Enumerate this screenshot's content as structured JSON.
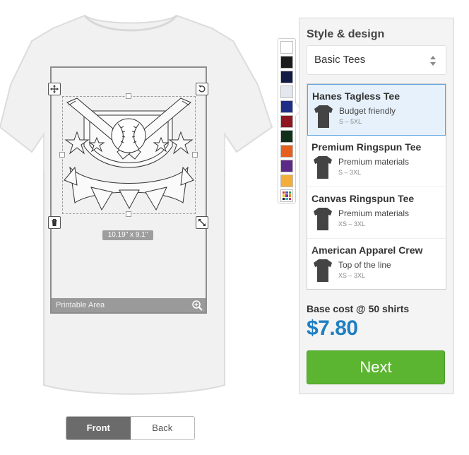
{
  "canvas": {
    "printable_area_label": "Printable Area",
    "dimensions_label": "10.19\" x 9.1\""
  },
  "palette": {
    "colors": [
      "#ffffff",
      "#1c1c1c",
      "#121a45",
      "#e4e8ee",
      "#1e2d86",
      "#8e1620",
      "#10301b",
      "#e4601c",
      "#5c2a86",
      "#f2ad3a"
    ],
    "multi_colors": [
      "#e03030",
      "#3060c0",
      "#30a040",
      "#f0c020",
      "#8030a0",
      "#f08020",
      "#202020",
      "#30b0c0",
      "#c03070"
    ]
  },
  "panel": {
    "title": "Style & design",
    "style_select": "Basic Tees",
    "products": [
      {
        "name": "Hanes Tagless Tee",
        "desc": "Budget friendly",
        "sizes": "S – 5XL"
      },
      {
        "name": "Premium Ringspun Tee",
        "desc": "Premium materials",
        "sizes": "S – 3XL"
      },
      {
        "name": "Canvas Ringspun Tee",
        "desc": "Premium materials",
        "sizes": "XS – 3XL"
      },
      {
        "name": "American Apparel Crew",
        "desc": "Top of the line",
        "sizes": "XS – 3XL"
      }
    ],
    "base_cost_label": "Base cost @ 50 shirts",
    "price": "$7.80",
    "next_label": "Next"
  },
  "view_toggle": {
    "front_label": "Front",
    "back_label": "Back"
  }
}
